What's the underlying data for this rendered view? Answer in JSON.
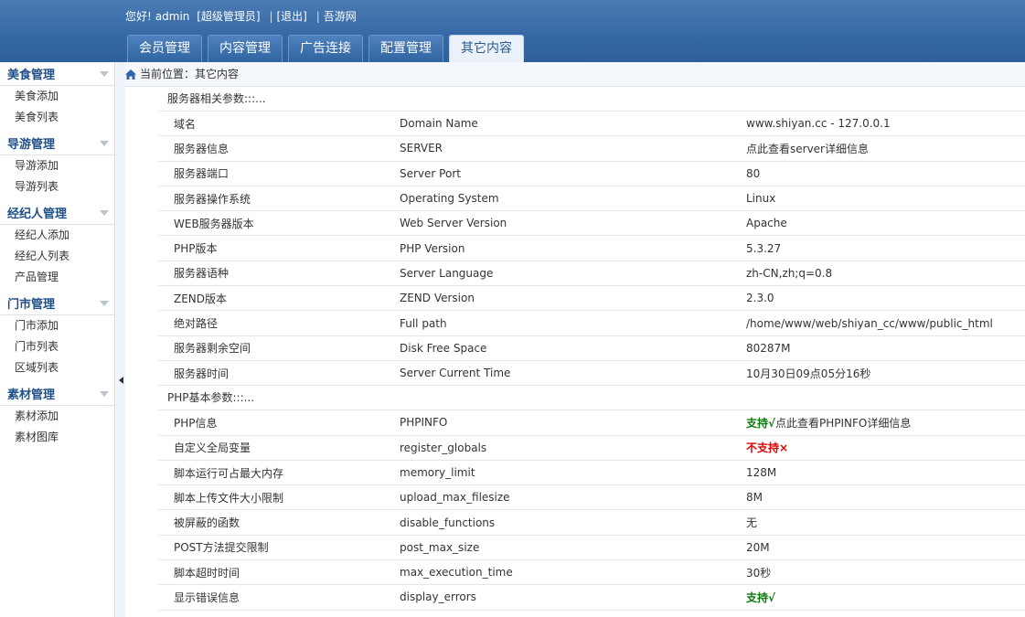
{
  "header": {
    "greeting": "您好!",
    "username": "admin",
    "role": "[超级管理员]",
    "logout": "[退出]",
    "site_name": "吾游网",
    "tabs": [
      {
        "label": "会员管理"
      },
      {
        "label": "内容管理"
      },
      {
        "label": "广告连接"
      },
      {
        "label": "配置管理"
      },
      {
        "label": "其它内容"
      }
    ]
  },
  "sidebar": {
    "groups": [
      {
        "title": "美食管理",
        "items": [
          "美食添加",
          "美食列表"
        ]
      },
      {
        "title": "导游管理",
        "items": [
          "导游添加",
          "导游列表"
        ]
      },
      {
        "title": "经纪人管理",
        "items": [
          "经纪人添加",
          "经纪人列表",
          "产品管理"
        ]
      },
      {
        "title": "门市管理",
        "items": [
          "门市添加",
          "门市列表",
          "区域列表"
        ]
      },
      {
        "title": "素材管理",
        "items": [
          "素材添加",
          "素材图库"
        ]
      }
    ]
  },
  "breadcrumb": {
    "text": "当前位置：其它内容"
  },
  "server_section": {
    "title": "服务器相关参数:::...",
    "rows": [
      {
        "name": "域名",
        "key": "Domain Name",
        "value": "www.shiyan.cc - 127.0.0.1"
      },
      {
        "name": "服务器信息",
        "key": "SERVER",
        "value": "点此查看server详细信息"
      },
      {
        "name": "服务器端口",
        "key": "Server Port",
        "value": "80"
      },
      {
        "name": "服务器操作系统",
        "key": "Operating System",
        "value": "Linux"
      },
      {
        "name": "WEB服务器版本",
        "key": "Web Server Version",
        "value": "Apache"
      },
      {
        "name": "PHP版本",
        "key": "PHP Version",
        "value": "5.3.27"
      },
      {
        "name": "服务器语种",
        "key": "Server Language",
        "value": "zh-CN,zh;q=0.8"
      },
      {
        "name": "ZEND版本",
        "key": "ZEND Version",
        "value": "2.3.0"
      },
      {
        "name": "绝对路径",
        "key": "Full path",
        "value": "/home/www/web/shiyan_cc/www/public_html"
      },
      {
        "name": "服务器剩余空间",
        "key": "Disk Free Space",
        "value": "80287M"
      },
      {
        "name": "服务器时间",
        "key": "Server Current Time",
        "value": "10月30日09点05分16秒"
      }
    ]
  },
  "php_section": {
    "title": "PHP基本参数:::...",
    "phpinfo": {
      "name": "PHP信息",
      "key": "PHPINFO",
      "status": "支持√",
      "link": "点此查看PHPINFO详细信息"
    },
    "register_globals": {
      "name": "自定义全局变量",
      "key": "register_globals",
      "status": "不支持×"
    },
    "memory_limit": {
      "name": "脚本运行可占最大内存",
      "key": "memory_limit",
      "value": "128M"
    },
    "upload_max": {
      "name": "脚本上传文件大小限制",
      "key": "upload_max_filesize",
      "value": "8M"
    },
    "disable_functions": {
      "name": "被屏蔽的函数",
      "key": "disable_functions",
      "value": "无"
    },
    "post_max": {
      "name": "POST方法提交限制",
      "key": "post_max_size",
      "value": "20M"
    },
    "max_exec": {
      "name": "脚本超时时间",
      "key": "max_execution_time",
      "value": "30秒"
    },
    "display_errors": {
      "name": "显示错误信息",
      "key": "display_errors",
      "status": "支持√"
    }
  },
  "colors": {
    "header_blue": "#3569a6",
    "ok_green": "#0a7a0a",
    "bad_red": "#e00000",
    "nav_title": "#1f4f89"
  },
  "icons": {
    "home": "home-icon",
    "group_arrow": "chevron-down-icon",
    "collapse": "chevron-left-icon"
  }
}
